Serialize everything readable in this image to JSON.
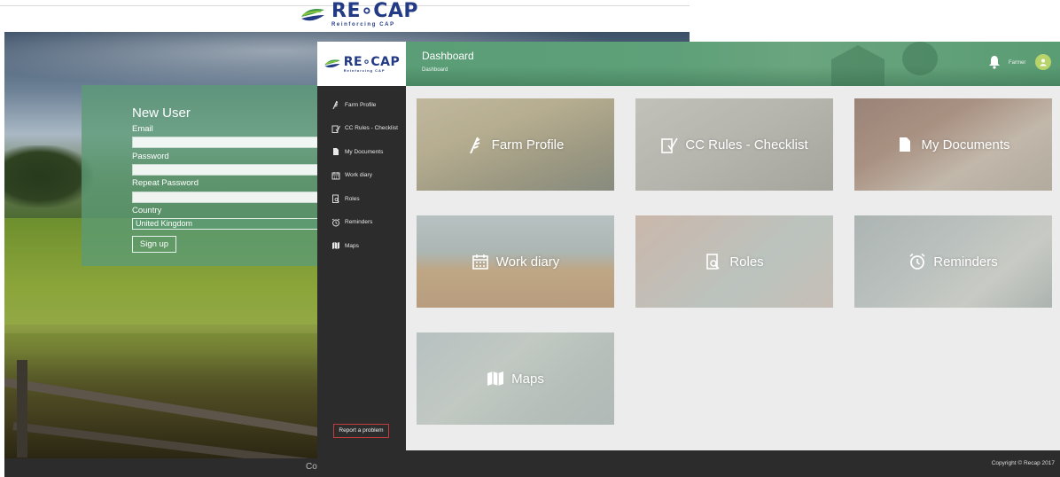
{
  "brand": {
    "name": "RE∘CAP",
    "tagline": "Reinforcing CAP"
  },
  "background_page": {
    "copyright_partial": "Cop",
    "new_user": {
      "title": "New User",
      "email_label": "Email",
      "email_value": "",
      "password_label": "Password",
      "password_value": "",
      "repeat_password_label": "Repeat Password",
      "repeat_password_value": "",
      "country_label": "Country",
      "country_value": "United Kingdom",
      "signup_label": "Sign up"
    }
  },
  "sidebar": {
    "items": [
      {
        "label": "Farm Profile",
        "icon": "wheat-icon"
      },
      {
        "label": "CC Rules - Checklist",
        "icon": "checklist-icon"
      },
      {
        "label": "My Documents",
        "icon": "documents-icon"
      },
      {
        "label": "Work diary",
        "icon": "calendar-icon"
      },
      {
        "label": "Roles",
        "icon": "roles-icon"
      },
      {
        "label": "Reminders",
        "icon": "alarm-icon"
      },
      {
        "label": "Maps",
        "icon": "map-icon"
      }
    ],
    "report_label": "Report a problem"
  },
  "header": {
    "title": "Dashboard",
    "breadcrumb": "Dashboard",
    "user_label": "Farmer"
  },
  "tiles": [
    {
      "label": "Farm Profile",
      "icon": "wheat-icon"
    },
    {
      "label": "CC Rules - Checklist",
      "icon": "checklist-icon"
    },
    {
      "label": "My Documents",
      "icon": "documents-icon"
    },
    {
      "label": "Work diary",
      "icon": "calendar-icon"
    },
    {
      "label": "Roles",
      "icon": "roles-icon"
    },
    {
      "label": "Reminders",
      "icon": "alarm-icon"
    },
    {
      "label": "Maps",
      "icon": "map-icon"
    }
  ],
  "footer": {
    "copyright": "Copyright © Recap 2017"
  },
  "colors": {
    "brand_navy": "#233a85",
    "brand_green": "#5a9d76",
    "sidebar_dark": "#2c2c2c",
    "content_bg": "#ececec",
    "report_border": "#c53b3b"
  }
}
